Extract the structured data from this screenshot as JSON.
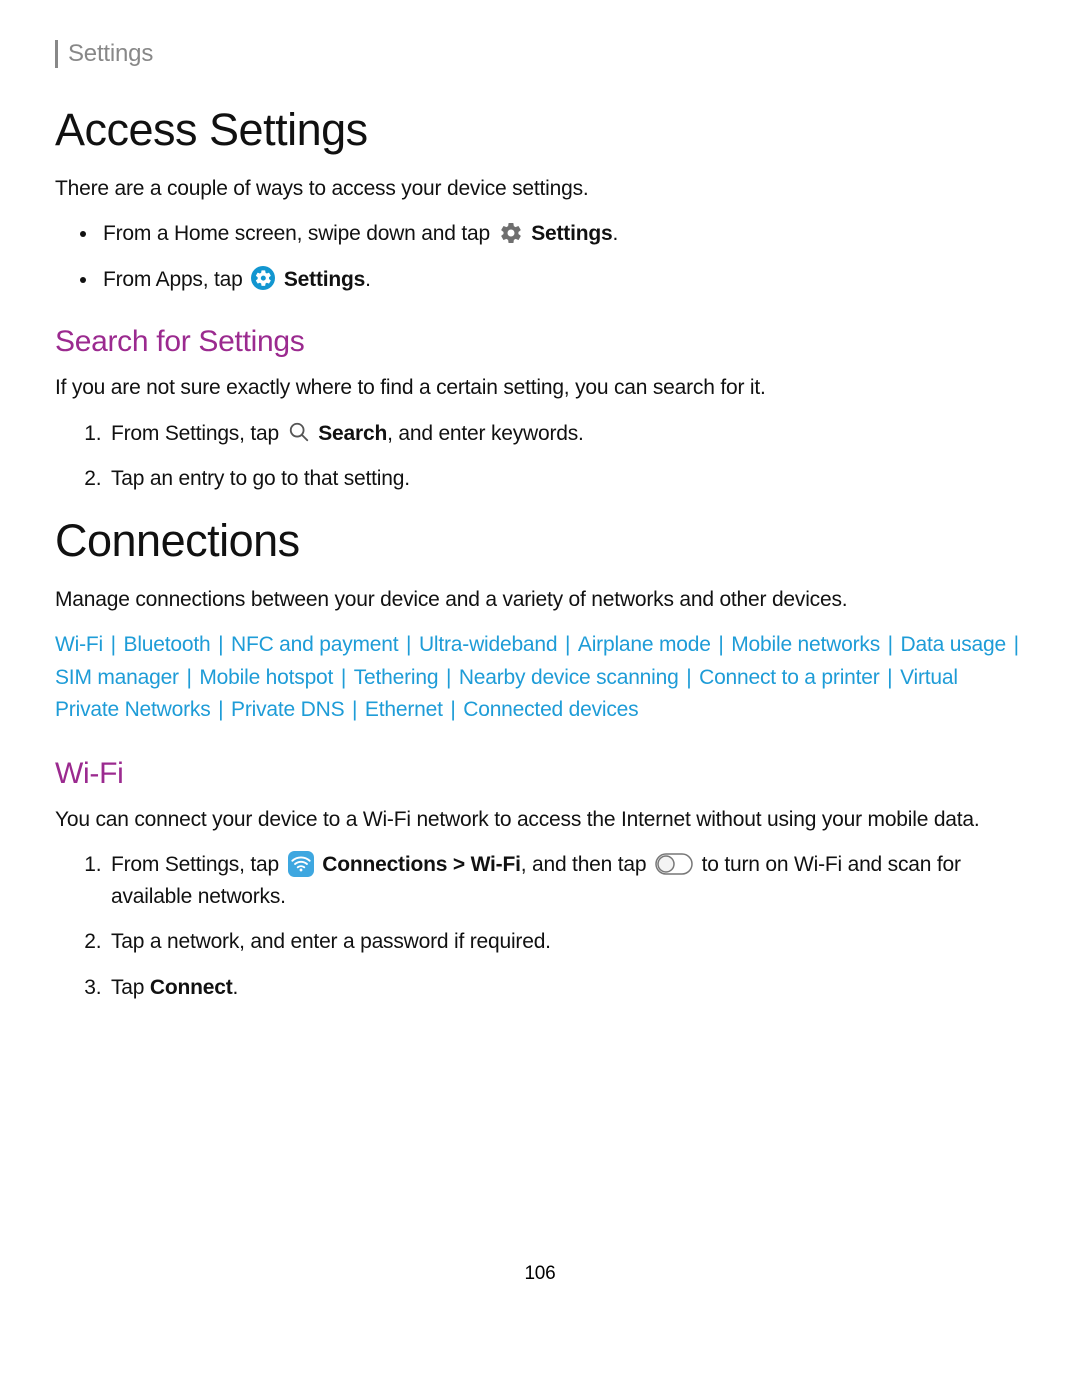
{
  "header": {
    "tab": "Settings"
  },
  "access": {
    "heading": "Access Settings",
    "intro": "There are a couple of ways to access your device settings.",
    "bullet1_a": "From a Home screen, swipe down and tap ",
    "bullet1_b": "Settings",
    "bullet1_c": ".",
    "bullet2_a": "From Apps, tap ",
    "bullet2_b": "Settings",
    "bullet2_c": "."
  },
  "search": {
    "heading": "Search for Settings",
    "intro": "If you are not sure exactly where to find a certain setting, you can search for it.",
    "step1_a": "From Settings, tap ",
    "step1_b": "Search",
    "step1_c": ", and enter keywords.",
    "step2": "Tap an entry to go to that setting."
  },
  "connections": {
    "heading": "Connections",
    "intro": "Manage connections between your device and a variety of networks and other devices.",
    "links": [
      "Wi-Fi",
      "Bluetooth",
      "NFC and payment",
      "Ultra-wideband",
      "Airplane mode",
      "Mobile networks",
      "Data usage",
      "SIM manager",
      "Mobile hotspot",
      "Tethering",
      "Nearby device scanning",
      "Connect to a printer",
      "Virtual Private Networks",
      "Private DNS",
      "Ethernet",
      "Connected devices"
    ]
  },
  "wifi": {
    "heading": "Wi-Fi",
    "intro": "You can connect your device to a Wi-Fi network to access the Internet without using your mobile data.",
    "step1_a": "From Settings, tap ",
    "step1_b": "Connections",
    "step1_c": " > ",
    "step1_d": "Wi-Fi",
    "step1_e": ", and then tap ",
    "step1_f": " to turn on Wi-Fi and scan for available networks.",
    "step2": "Tap a network, and enter a password if required.",
    "step3_a": "Tap ",
    "step3_b": "Connect",
    "step3_c": "."
  },
  "page_number": "106"
}
